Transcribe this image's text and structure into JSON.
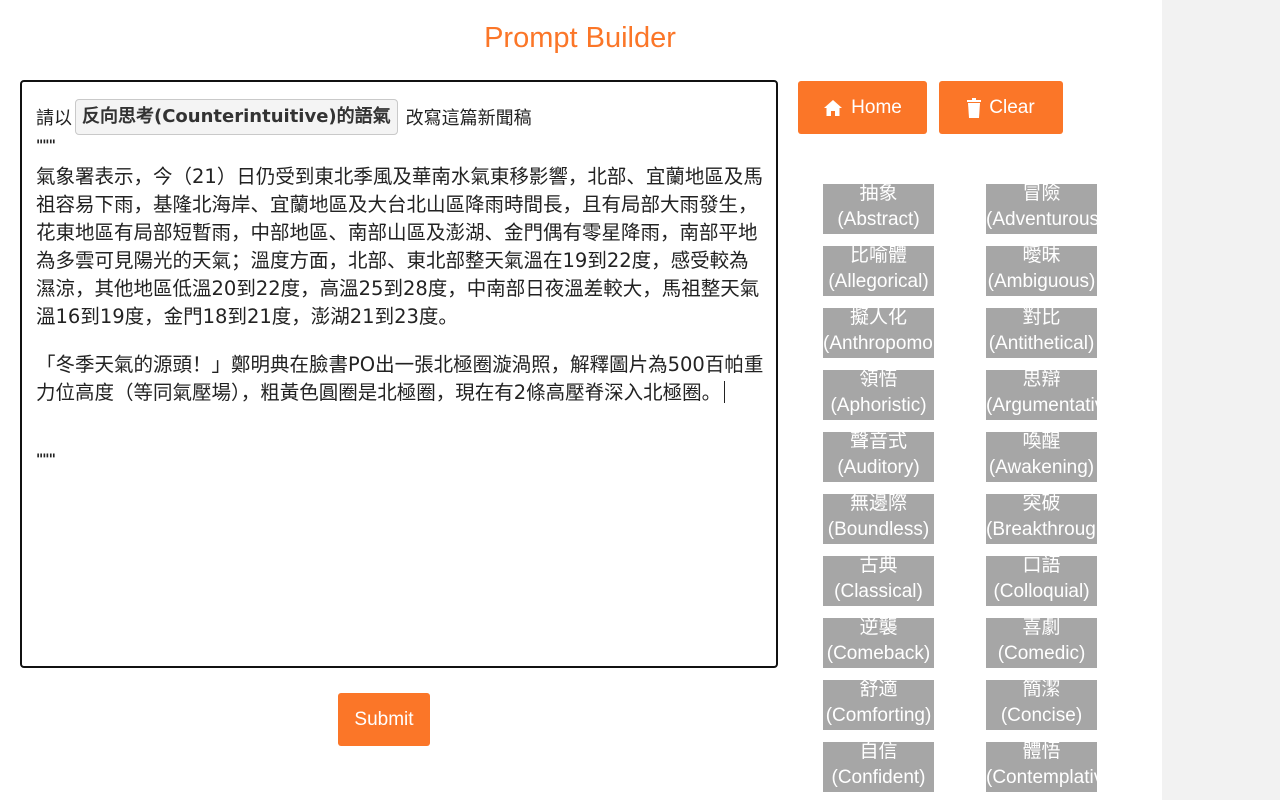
{
  "header": {
    "title": "Prompt Builder"
  },
  "editor": {
    "prefix": "請以",
    "tone_chip": "反向思考(Counterintuitive)的語氣",
    "suffix": "改寫這篇新聞稿",
    "open_quotes": "\"\"\"",
    "paragraph1": "氣象署表示，今（21）日仍受到東北季風及華南水氣東移影響，北部、宜蘭地區及馬祖容易下雨，基隆北海岸、宜蘭地區及大台北山區降雨時間長，且有局部大雨發生，花東地區有局部短暫雨，中部地區、南部山區及澎湖、金門偶有零星降雨，南部平地為多雲可見陽光的天氣；溫度方面，北部、東北部整天氣溫在19到22度，感受較為濕涼，其他地區低溫20到22度，高溫25到28度，中南部日夜溫差較大，馬祖整天氣溫16到19度，金門18到21度，澎湖21到23度。",
    "paragraph2": "「冬季天氣的源頭！」鄭明典在臉書PO出一張北極圈漩渦照，解釋圖片為500百帕重力位高度（等同氣壓場），粗黃色圓圈是北極圈，現在有2條高壓脊深入北極圈。",
    "close_quotes": "\"\"\""
  },
  "buttons": {
    "submit": "Submit",
    "home": "Home",
    "clear": "Clear"
  },
  "tones": [
    {
      "zh": "抽象",
      "en": "(Abstract)"
    },
    {
      "zh": "冒險",
      "en": "(Adventurous)"
    },
    {
      "zh": "比喻體",
      "en": "(Allegorical)"
    },
    {
      "zh": "曖昧",
      "en": "(Ambiguous)"
    },
    {
      "zh": "擬人化",
      "en": "(Anthropomorphic)"
    },
    {
      "zh": "對比",
      "en": "(Antithetical)"
    },
    {
      "zh": "領悟",
      "en": "(Aphoristic)"
    },
    {
      "zh": "思辯",
      "en": "(Argumentative)"
    },
    {
      "zh": "聲音式",
      "en": "(Auditory)"
    },
    {
      "zh": "喚醒",
      "en": "(Awakening)"
    },
    {
      "zh": "無邊際",
      "en": "(Boundless)"
    },
    {
      "zh": "突破",
      "en": "(Breakthrough)"
    },
    {
      "zh": "古典",
      "en": "(Classical)"
    },
    {
      "zh": "口語",
      "en": "(Colloquial)"
    },
    {
      "zh": "逆襲",
      "en": "(Comeback)"
    },
    {
      "zh": "喜劇",
      "en": "(Comedic)"
    },
    {
      "zh": "舒適",
      "en": "(Comforting)"
    },
    {
      "zh": "簡潔",
      "en": "(Concise)"
    },
    {
      "zh": "自信",
      "en": "(Confident)"
    },
    {
      "zh": "體悟",
      "en": "(Contemplative)"
    }
  ],
  "colors": {
    "accent": "#fb7628",
    "tone_bg": "#a6a6a6"
  },
  "icons": {
    "home": "home-icon",
    "clear": "trash-icon"
  }
}
